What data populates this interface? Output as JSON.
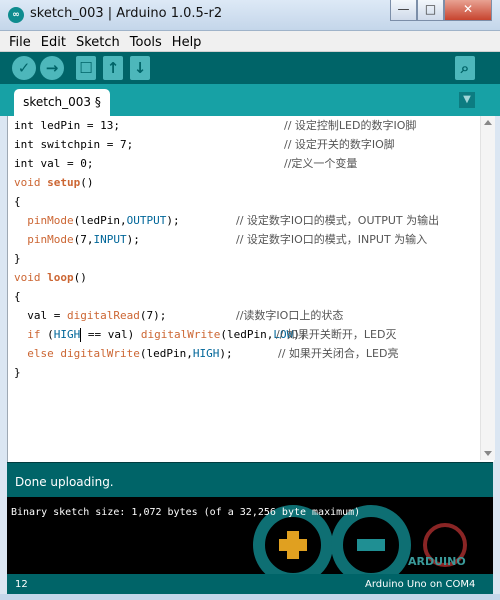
{
  "window": {
    "title": "sketch_003 | Arduino 1.0.5-r2",
    "app_icon": "arduino-logo-icon",
    "buttons": {
      "minimize": "—",
      "maximize": "□",
      "close": "✕"
    }
  },
  "menu": {
    "items": [
      "File",
      "Edit",
      "Sketch",
      "Tools",
      "Help"
    ]
  },
  "toolbar": {
    "buttons": [
      {
        "name": "verify",
        "icon": "check-icon",
        "glyph": "✓"
      },
      {
        "name": "upload",
        "icon": "arrow-right-icon",
        "glyph": "→"
      },
      {
        "name": "new",
        "icon": "new-file-icon",
        "glyph": "☐"
      },
      {
        "name": "open",
        "icon": "arrow-up-icon",
        "glyph": "↑"
      },
      {
        "name": "save",
        "icon": "arrow-down-icon",
        "glyph": "↓"
      },
      {
        "name": "serial-monitor",
        "icon": "magnifier-icon",
        "glyph": "⌕"
      }
    ]
  },
  "tabs": {
    "active": "sketch_003 §",
    "menu_glyph": "▼"
  },
  "code": {
    "l1": {
      "code": "int ledPin = 13;",
      "comment": "// 设定控制LED的数字IO脚"
    },
    "l2": {
      "code": "int switchpin = 7;",
      "comment": "// 设定开关的数字IO脚"
    },
    "l3": {
      "code": "int val = 0;",
      "comment": "//定义一个变量"
    },
    "l4": {
      "kw": "void",
      "fn": "setup",
      "rest": "()"
    },
    "l5": "{",
    "l6": {
      "fn": "pinMode",
      "open": "(ledPin,",
      "const": "OUTPUT",
      "close": ");",
      "comment": "// 设定数字IO口的模式，OUTPUT 为输出"
    },
    "l7": {
      "fn": "pinMode",
      "open": "(7,",
      "const": "INPUT",
      "close": ");",
      "comment": "// 设定数字IO口的模式，INPUT 为输入"
    },
    "l8": "}",
    "l9": {
      "kw": "void",
      "fn": "loop",
      "rest": "()"
    },
    "l10": "{",
    "l11": {
      "pre": "val = ",
      "fn": "digitalRead",
      "post": "(7);",
      "comment": "//读数字IO口上的状态"
    },
    "l12": {
      "kw": "if",
      "pre": " (",
      "const1": "HIGH",
      "mid": " == val) ",
      "fn": "digitalWrite",
      "open": "(ledPin,",
      "const2": "LOW",
      "close": ");",
      "comment": "// 如果开关断开，LED灭"
    },
    "l13": {
      "kw": "else",
      "fn": "digitalWrite",
      "open": "(ledPin,",
      "const": "HIGH",
      "close": ");",
      "comment": "// 如果开关闭合，LED亮"
    },
    "l14": "}"
  },
  "status": {
    "message": "Done uploading."
  },
  "console": {
    "text": "Binary sketch size: 1,072 bytes (of a 32,256 byte maximum)",
    "logo_word": "ARDUINO"
  },
  "footer": {
    "line": "12",
    "board": "Arduino Uno on COM4"
  },
  "colors": {
    "toolbar": "#006468",
    "tabbar": "#17a1a5",
    "button": "#4db7bb",
    "keyword": "#cc6633",
    "constant": "#006699"
  }
}
